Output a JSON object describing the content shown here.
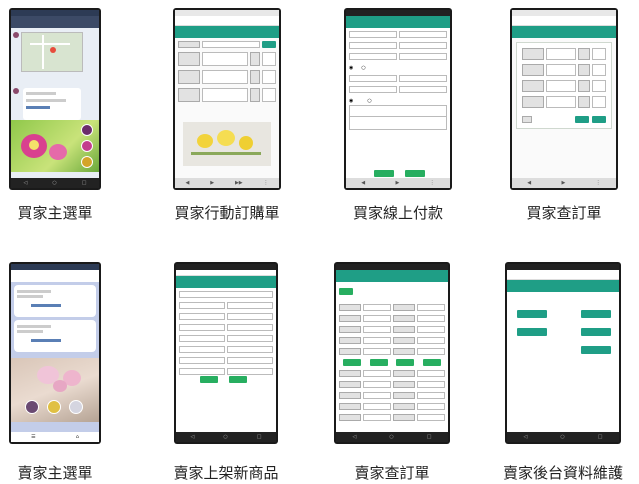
{
  "captions": {
    "buyer_main_menu": "買家主選單",
    "buyer_mobile_order": "買家行動訂購單",
    "buyer_online_payment": "買家線上付款",
    "buyer_check_order": "買家查訂單",
    "seller_main_menu": "賣家主選單",
    "seller_new_product": "賣家上架新商品",
    "seller_check_order": "賣家查訂單",
    "seller_backend": "賣家後台資料維護"
  },
  "colors": {
    "bezel": "#1a1a1a",
    "teal": "#1f9e86",
    "blue_bar": "#2e5f7a",
    "orchid_pink": "#d9418f",
    "orchid_yellow": "#f2d33b"
  }
}
